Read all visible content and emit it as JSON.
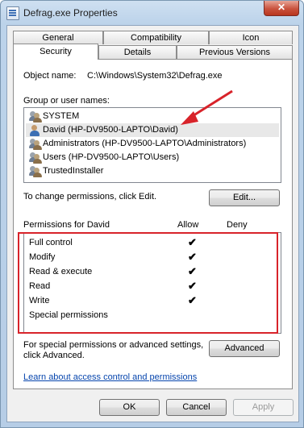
{
  "window": {
    "title": "Defrag.exe Properties",
    "close_glyph": "✕"
  },
  "tabs": {
    "row1": [
      "General",
      "Compatibility",
      "Icon"
    ],
    "row2": [
      "Security",
      "Details",
      "Previous Versions"
    ],
    "active": "Security"
  },
  "object": {
    "label": "Object name:",
    "value": "C:\\Windows\\System32\\Defrag.exe"
  },
  "groups": {
    "label": "Group or user names:",
    "items": [
      {
        "name": "SYSTEM",
        "icon": "group-icon"
      },
      {
        "name": "David (HP-DV9500-LAPTO\\David)",
        "icon": "user-icon",
        "selected": true
      },
      {
        "name": "Administrators (HP-DV9500-LAPTO\\Administrators)",
        "icon": "group-icon"
      },
      {
        "name": "Users (HP-DV9500-LAPTO\\Users)",
        "icon": "group-icon"
      },
      {
        "name": "TrustedInstaller",
        "icon": "group-icon"
      }
    ]
  },
  "change": {
    "text": "To change permissions, click Edit.",
    "edit_label": "Edit..."
  },
  "permissions": {
    "title": "Permissions for David",
    "allow_label": "Allow",
    "deny_label": "Deny",
    "check_glyph": "✔",
    "rows": [
      {
        "name": "Full control",
        "allow": true,
        "deny": false
      },
      {
        "name": "Modify",
        "allow": true,
        "deny": false
      },
      {
        "name": "Read & execute",
        "allow": true,
        "deny": false
      },
      {
        "name": "Read",
        "allow": true,
        "deny": false
      },
      {
        "name": "Write",
        "allow": true,
        "deny": false
      },
      {
        "name": "Special permissions",
        "allow": false,
        "deny": false
      }
    ]
  },
  "advanced": {
    "line1": "For special permissions or advanced settings,",
    "line2": "click Advanced.",
    "button_label": "Advanced"
  },
  "learn_link": "Learn about access control and permissions",
  "footer": {
    "ok": "OK",
    "cancel": "Cancel",
    "apply": "Apply"
  },
  "colors": {
    "annotation_red": "#d8232a",
    "link": "#0645ad"
  }
}
